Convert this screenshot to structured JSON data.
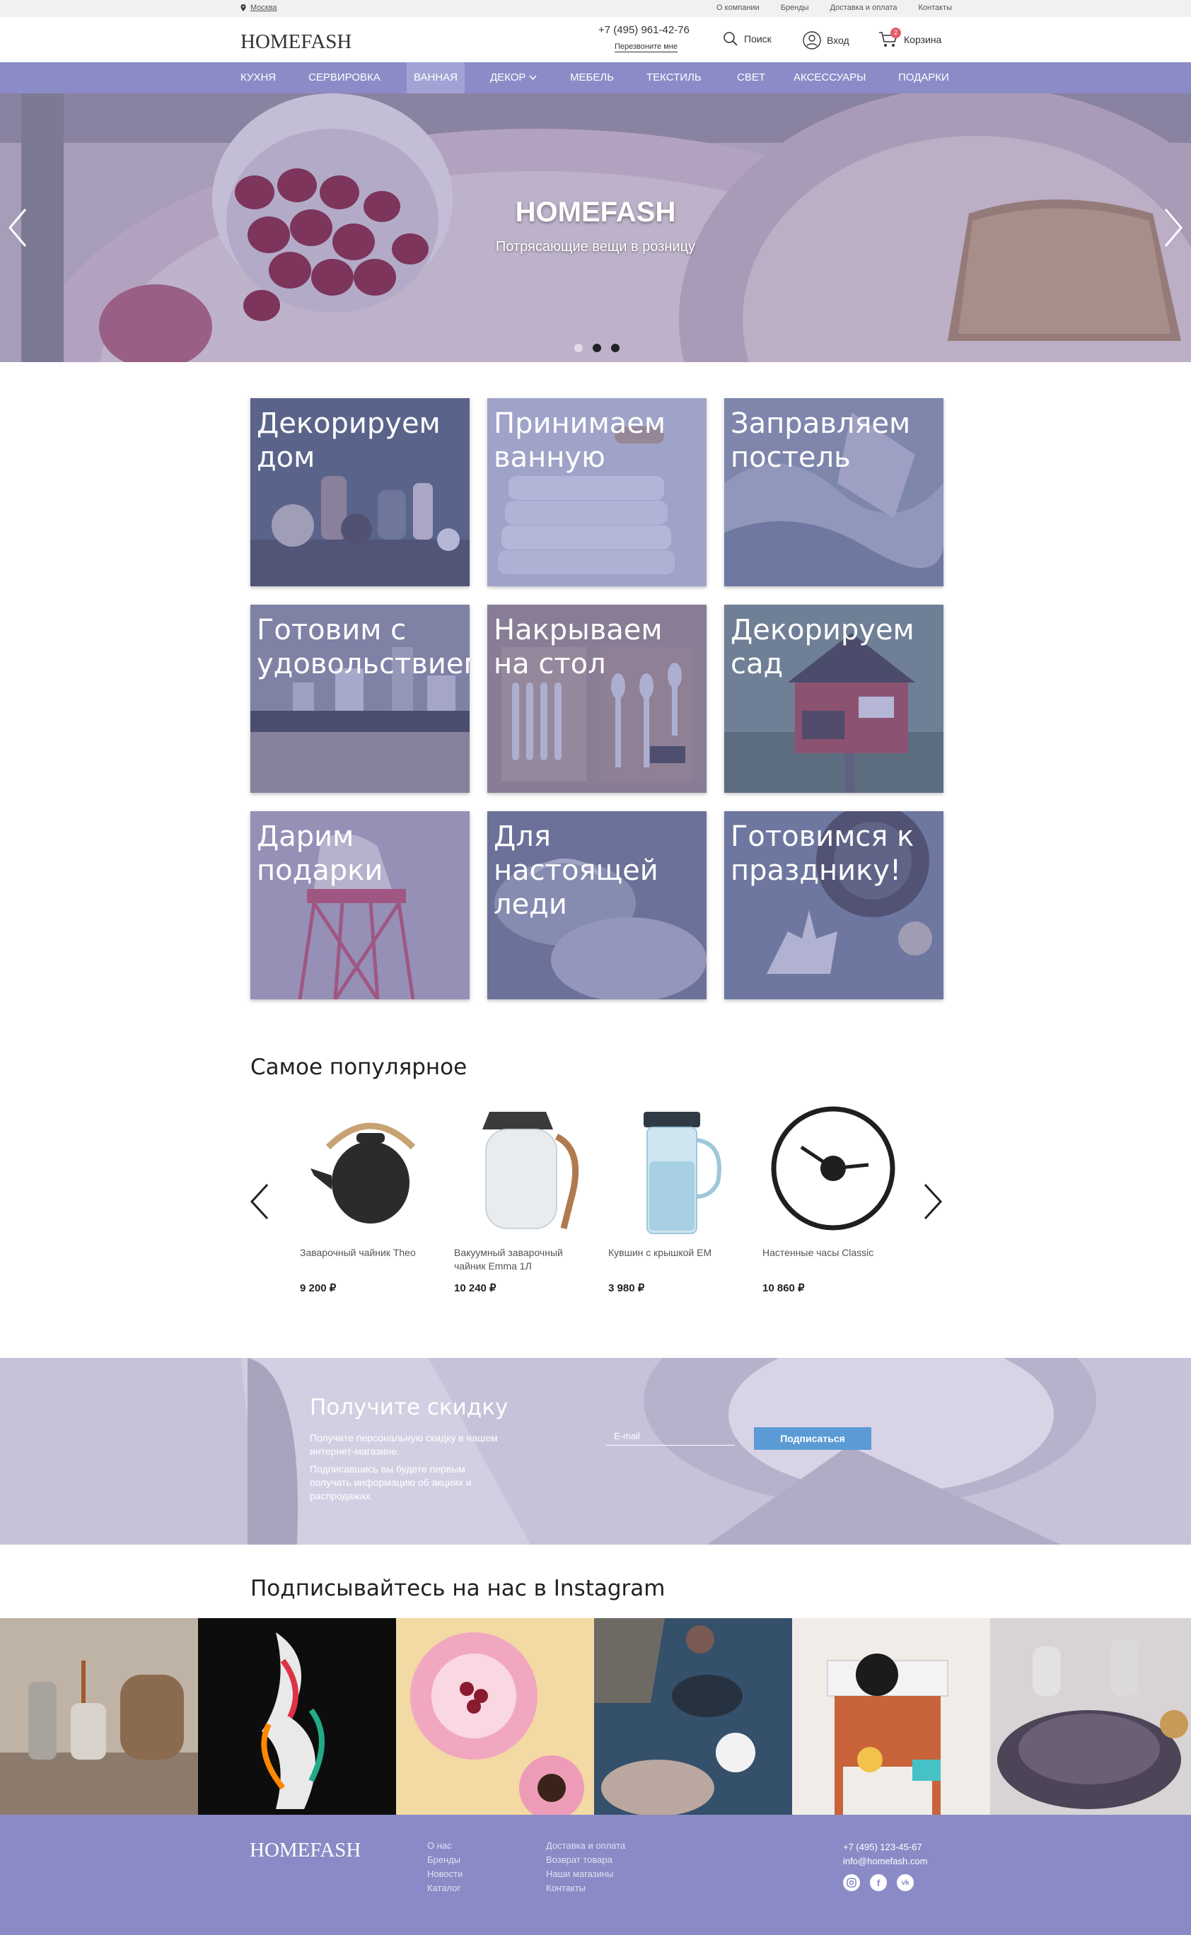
{
  "topbar": {
    "city": "Москва",
    "links": [
      "О компании",
      "Бренды",
      "Доставка и оплата",
      "Контакты"
    ]
  },
  "header": {
    "logo": "HOMEFASH",
    "phone": "+7 (495) 961-42-76",
    "callback": "Перезвоните мне",
    "search": "Поиск",
    "login": "Вход",
    "cart": "Корзина",
    "cart_count": "2"
  },
  "nav": {
    "items": [
      "КУХНЯ",
      "СЕРВИРОВКА",
      "ВАННАЯ",
      "ДЕКОР",
      "МЕБЕЛЬ",
      "ТЕКСТИЛЬ",
      "СВЕТ",
      "АКСЕССУАРЫ",
      "ПОДАРКИ"
    ],
    "active": "ВАННАЯ"
  },
  "hero": {
    "title": "HOMEFASH",
    "subtitle": "Потрясающие вещи в розницу",
    "slides": 3,
    "active_slide": 2
  },
  "categories": [
    "Декорируем дом",
    "Принимаем ванную",
    "Заправляем постель",
    "Готовим с удовольствием",
    "Накрываем на стол",
    "Декорируем сад",
    "Дарим подарки",
    "Для настоящей леди",
    "Готовимся к празднику!"
  ],
  "popular": {
    "title": "Самое популярное",
    "products": [
      {
        "name": "Заварочный чайник Theo",
        "price": "9 200 ₽"
      },
      {
        "name": "Вакуумный заварочный чайник Emma 1Л",
        "price": "10 240 ₽"
      },
      {
        "name": "Кувшин с крышкой EM",
        "price": "3 980 ₽"
      },
      {
        "name": "Настенные часы Classic",
        "price": "10 860 ₽"
      }
    ]
  },
  "promo": {
    "title": "Получите скидку",
    "text1": "Получите персональную скидку в нашем интернет-магазине.",
    "text2": "Подписавшись вы будете первым получать информацию об акциях и распродажах.",
    "email_placeholder": "E-mail",
    "button": "Подписаться"
  },
  "instagram": {
    "title": "Подписывайтесь на нас в Instagram"
  },
  "footer": {
    "logo": "HOMEFASH",
    "col1": [
      "О нас",
      "Бренды",
      "Новости",
      "Каталог"
    ],
    "col2": [
      "Доставка и оплата",
      "Возврат товара",
      "Наши магазины",
      "Контакты"
    ],
    "phone": "+7 (495) 123-45-67",
    "email": "info@homefash.com",
    "social": [
      "instagram-icon",
      "facebook-icon",
      "vk-icon"
    ]
  },
  "colors": {
    "nav": "#8b8cc7",
    "accent": "#5b9bd5",
    "badge": "#e35b6b",
    "footer": "#8a8bc6"
  }
}
